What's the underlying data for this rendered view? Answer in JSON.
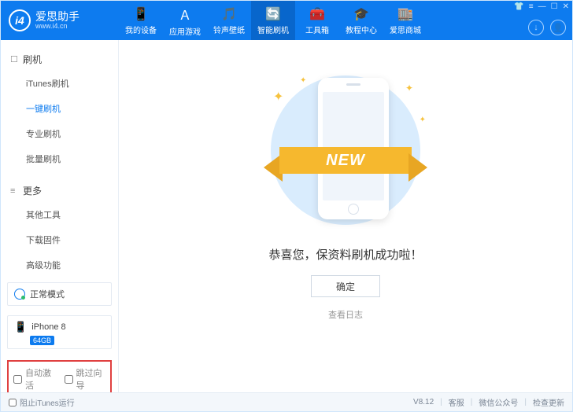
{
  "brand": {
    "name": "爱思助手",
    "url": "www.i4.cn",
    "logo_glyph": "i4"
  },
  "nav": [
    {
      "icon": "📱",
      "label": "我的设备"
    },
    {
      "icon": "Ａ",
      "label": "应用游戏"
    },
    {
      "icon": "🎵",
      "label": "铃声壁纸"
    },
    {
      "icon": "🔄",
      "label": "智能刷机",
      "active": true
    },
    {
      "icon": "🧰",
      "label": "工具箱"
    },
    {
      "icon": "🎓",
      "label": "教程中心"
    },
    {
      "icon": "🏬",
      "label": "爱思商城"
    }
  ],
  "sidebar": {
    "sections": [
      {
        "icon": "☐",
        "title": "刷机",
        "items": [
          "iTunes刷机",
          "一键刷机",
          "专业刷机",
          "批量刷机"
        ],
        "activeIndex": 1
      },
      {
        "icon": "≡",
        "title": "更多",
        "items": [
          "其他工具",
          "下载固件",
          "高级功能"
        ],
        "activeIndex": -1
      }
    ],
    "mode_label": "正常模式",
    "device_name": "iPhone 8",
    "device_storage": "64GB",
    "checkboxes": {
      "auto_activate": "自动激活",
      "skip_guide": "跳过向导"
    }
  },
  "main": {
    "ribbon_text": "NEW",
    "message": "恭喜您，保资料刷机成功啦！",
    "ok_button": "确定",
    "view_log": "查看日志"
  },
  "footer": {
    "block_itunes": "阻止iTunes运行",
    "version": "V8.12",
    "links": [
      "客服",
      "微信公众号",
      "检查更新"
    ]
  }
}
